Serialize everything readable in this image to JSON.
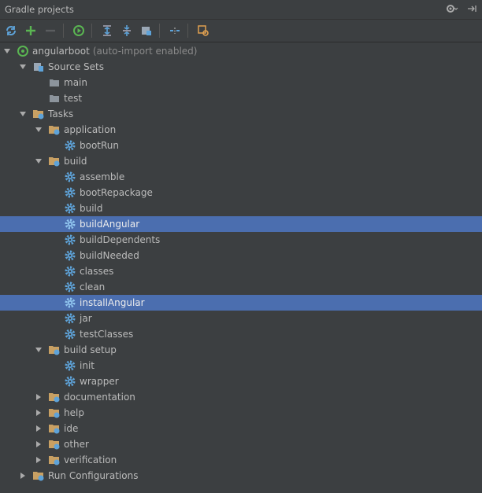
{
  "panel": {
    "title": "Gradle projects"
  },
  "toolbar": {
    "buttons": [
      "refresh-icon",
      "add-icon",
      "remove-icon",
      "execute-task-icon",
      "expand-all-icon",
      "collapse-all-icon",
      "toggle-offline-icon",
      "link-icon",
      "settings-icon"
    ]
  },
  "tree": {
    "root": {
      "label": "angularboot",
      "suffix": "(auto-import enabled)"
    },
    "source_sets": {
      "label": "Source Sets",
      "items": [
        "main",
        "test"
      ]
    },
    "tasks": {
      "label": "Tasks",
      "application": {
        "label": "application",
        "items": [
          "bootRun"
        ]
      },
      "build": {
        "label": "build",
        "items": [
          "assemble",
          "bootRepackage",
          "build",
          "buildAngular",
          "buildDependents",
          "buildNeeded",
          "classes",
          "clean",
          "installAngular",
          "jar",
          "testClasses"
        ]
      },
      "build_setup": {
        "label": "build setup",
        "items": [
          "init",
          "wrapper"
        ]
      },
      "collapsed_groups": [
        "documentation",
        "help",
        "ide",
        "other",
        "verification"
      ]
    },
    "run_configurations": {
      "label": "Run Configurations"
    }
  },
  "selection": [
    "buildAngular",
    "installAngular"
  ],
  "colors": {
    "selection": "#4b6eaf",
    "background": "#3c3f41",
    "gear": "#5ea3d9",
    "folder": "#c8a063"
  }
}
